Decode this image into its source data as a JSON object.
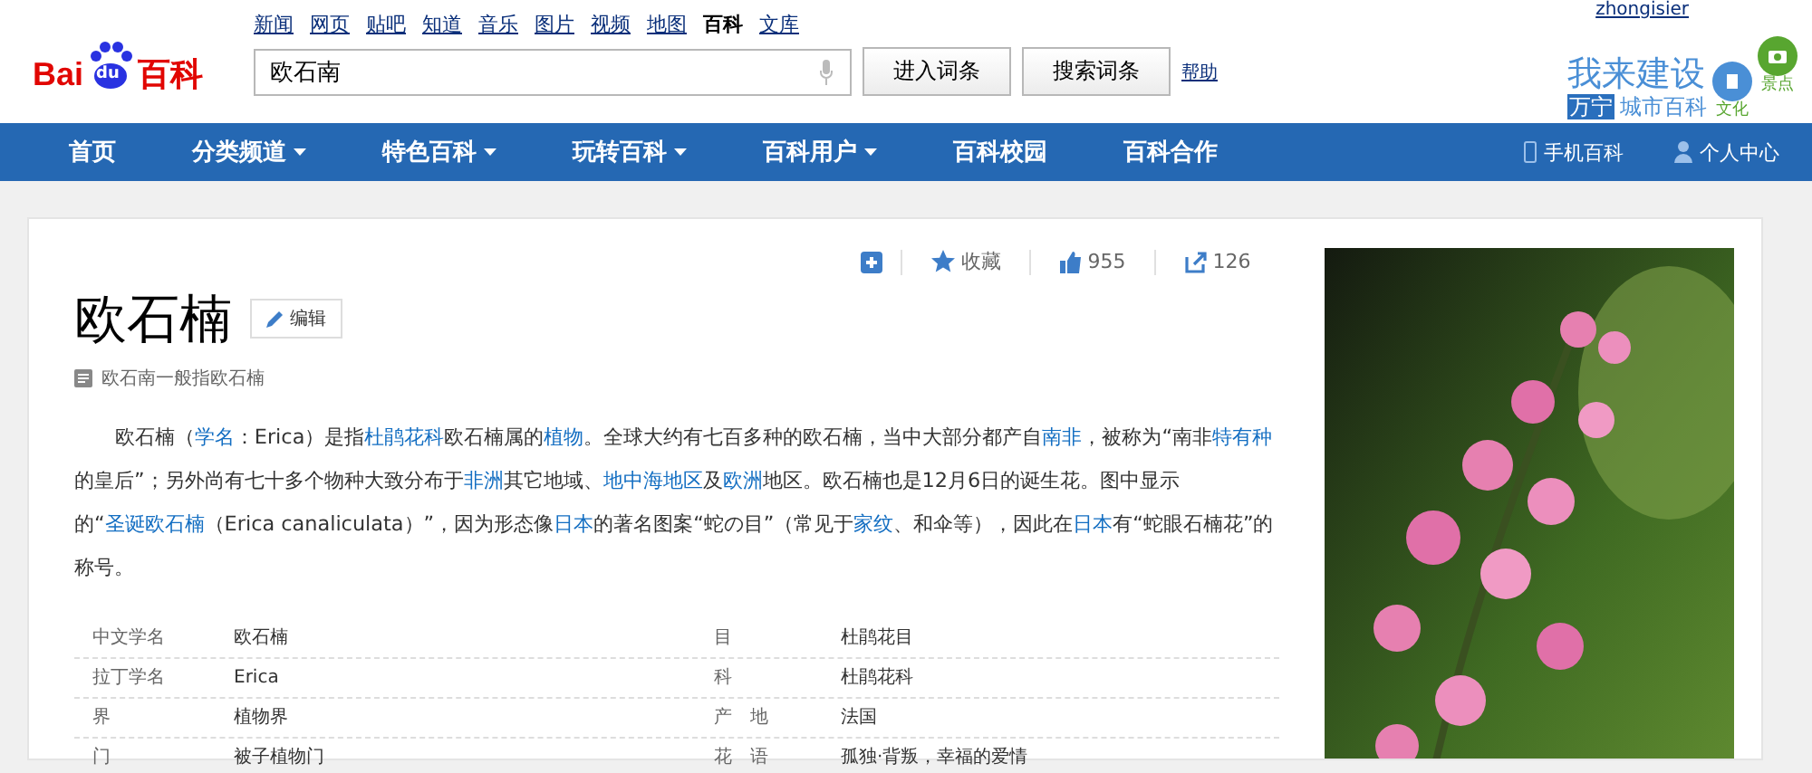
{
  "top_links": [
    {
      "label": "新闻",
      "selected": false
    },
    {
      "label": "网页",
      "selected": false
    },
    {
      "label": "贴吧",
      "selected": false
    },
    {
      "label": "知道",
      "selected": false
    },
    {
      "label": "音乐",
      "selected": false
    },
    {
      "label": "图片",
      "selected": false
    },
    {
      "label": "视频",
      "selected": false
    },
    {
      "label": "地图",
      "selected": false
    },
    {
      "label": "百科",
      "selected": true
    },
    {
      "label": "文库",
      "selected": false
    }
  ],
  "logo": {
    "part_1": "Bai",
    "part_2": "du",
    "part_3": "百科"
  },
  "search": {
    "value": "欧石南"
  },
  "buttons": [
    "进入词条",
    "搜索词条"
  ],
  "help": "帮助",
  "user": "zhongisier",
  "promo": {
    "title": "我来建设",
    "city": "万宁",
    "subtitle": "城市百科",
    "badges": [
      "文化",
      "景点"
    ]
  },
  "nav": {
    "items": [
      {
        "label": "首页",
        "dropdown": false
      },
      {
        "label": "分类频道",
        "dropdown": true
      },
      {
        "label": "特色百科",
        "dropdown": true
      },
      {
        "label": "玩转百科",
        "dropdown": true
      },
      {
        "label": "百科用户",
        "dropdown": true
      },
      {
        "label": "百科校园",
        "dropdown": false
      },
      {
        "label": "百科合作",
        "dropdown": false
      }
    ],
    "right": [
      {
        "kind": "phone",
        "label": "手机百科"
      },
      {
        "kind": "person",
        "label": "个人中心"
      }
    ]
  },
  "article": {
    "title": "欧石楠",
    "edit": "编辑",
    "collect": "收藏",
    "likes": "955",
    "shares": "126",
    "polysemy": "欧石南一般指欧石楠",
    "paragraph": [
      {
        "text": "欧石楠（",
        "link": false
      },
      {
        "text": "学名",
        "link": true
      },
      {
        "text": "：Erica）是指",
        "link": false
      },
      {
        "text": "杜鹃花科",
        "link": true
      },
      {
        "text": "欧石楠属的",
        "link": false
      },
      {
        "text": "植物",
        "link": true
      },
      {
        "text": "。全球大约有七百多种的欧石楠，当中大部分都产自",
        "link": false
      },
      {
        "text": "南非",
        "link": true
      },
      {
        "text": "，被称为“南非",
        "link": false
      },
      {
        "text": "特有种",
        "link": true
      },
      {
        "text": "的皇后”；另外尚有七十多个物种大致分布于",
        "link": false
      },
      {
        "text": "非洲",
        "link": true
      },
      {
        "text": "其它地域、",
        "link": false
      },
      {
        "text": "地中海地区",
        "link": true
      },
      {
        "text": "及",
        "link": false
      },
      {
        "text": "欧洲",
        "link": true
      },
      {
        "text": "地区。欧石楠也是12月6日的诞生花。图中显示的“",
        "link": false
      },
      {
        "text": "圣诞欧石楠",
        "link": true
      },
      {
        "text": "（Erica canaliculata）”，因为形态像",
        "link": false
      },
      {
        "text": "日本",
        "link": true
      },
      {
        "text": "的著名图案“蛇の目”（常见于",
        "link": false
      },
      {
        "text": "家纹",
        "link": true
      },
      {
        "text": "、和伞等），因此在",
        "link": false
      },
      {
        "text": "日本",
        "link": true
      },
      {
        "text": "有“蛇眼石楠花”的称号。",
        "link": false
      }
    ],
    "info": [
      {
        "name": "中文学名",
        "value": "欧石楠",
        "name_2": "目",
        "value_2": "杜鹃花目"
      },
      {
        "name": "拉丁学名",
        "value": "Erica",
        "name_2": "科",
        "value_2": "杜鹃花科"
      },
      {
        "name": "界",
        "value": "植物界",
        "name_2": "产　地",
        "value_2": "法国"
      },
      {
        "name": "门",
        "value": "被子植物门",
        "name_2": "花　语",
        "value_2": "孤独·背叛，幸福的爱情"
      }
    ]
  }
}
